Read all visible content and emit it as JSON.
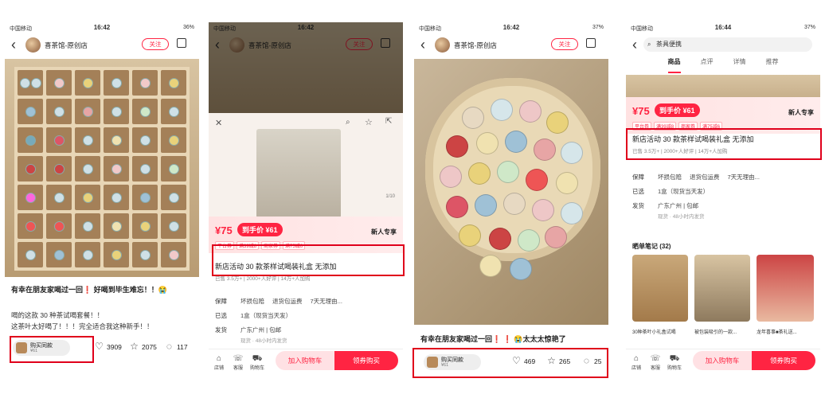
{
  "status": {
    "carrier": "中国移动",
    "time1": "16:42",
    "time2": "16:42",
    "time3": "16:42",
    "time4": "16:44",
    "batt1": "36%",
    "batt3": "37%",
    "batt4": "37%"
  },
  "shop": {
    "name": "喜茶馆-原创店",
    "follow": "关注"
  },
  "post": {
    "caption1": "有幸在朋友家喝过一回❗ 好喝到毕生难忘！！😭",
    "body1a": "喝的这款 30 种茶试喝套餐！！",
    "body1b": "这茶叶太好喝了！！！完全适合我这种新手！！",
    "caption3": "有幸在朋友家喝过一回❗ ❗ 😭太太太惊艳了"
  },
  "buy_same": {
    "label": "购买同款",
    "price": "¥61"
  },
  "stats1": {
    "likes": "3909",
    "stars": "2075",
    "comments": "117"
  },
  "stats3": {
    "likes": "469",
    "stars": "265",
    "comments": "25"
  },
  "product": {
    "price": "¥75",
    "deal": "到手价 ¥61",
    "newspec": "新人专享",
    "tags": [
      "平台券",
      "满39减8",
      "商家券",
      "满75减6"
    ],
    "title": "新店活动 30 款茶样试喝装礼盒 无添加",
    "sold": "已售 3.5万+",
    "good": "2000+人好评",
    "fav": "14万+人加购",
    "counter": "1/10"
  },
  "service": {
    "k1": "保障",
    "v1a": "坏损包赔",
    "v1b": "退货包运费",
    "v1c": "7天无理由...",
    "k2": "已选",
    "v2": "1盒（现货当天发）",
    "k3": "发货",
    "v3": "广东广州 | 包邮",
    "v3b": "现货 · 48小时内发货"
  },
  "bottom": {
    "shop": "店铺",
    "service": "客服",
    "cart": "购物车",
    "add": "加入购物车",
    "buy": "领券购买"
  },
  "search": {
    "query": "茶具便携"
  },
  "tabs": [
    "商品",
    "点评",
    "详情",
    "推荐"
  ],
  "notes": {
    "title": "晒单笔记 (32)",
    "c1": "30种茶叶小礼盒试喝",
    "c2": "被包装吸引的一款...",
    "c3": "龙年喜事■茶礼送..."
  },
  "colors": {
    "accent": "#ff2442",
    "highlight": "#e0001b"
  }
}
